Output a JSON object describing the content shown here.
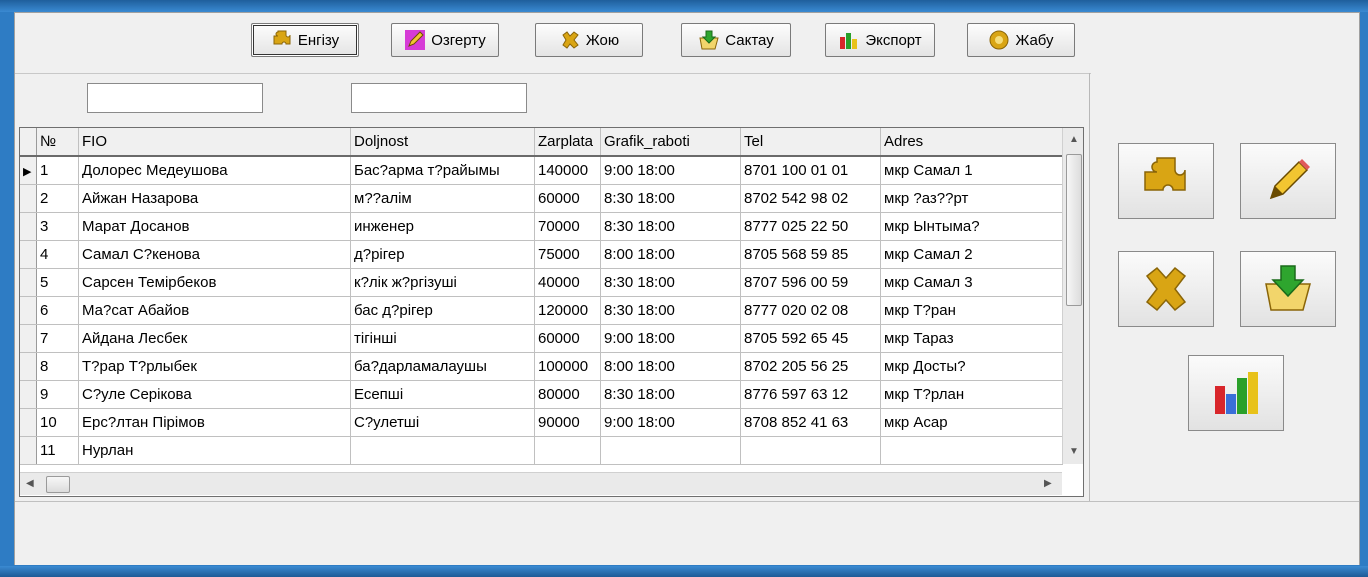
{
  "toolbar": {
    "buttons": [
      {
        "label": "Енгізу",
        "icon": "puzzle-icon"
      },
      {
        "label": "Озгерту",
        "icon": "pencil-icon"
      },
      {
        "label": "Жою",
        "icon": "delete-puzzle-icon"
      },
      {
        "label": "Сактау",
        "icon": "save-icon"
      },
      {
        "label": "Экспорт",
        "icon": "chart-icon"
      },
      {
        "label": "Жабу",
        "icon": "exit-icon"
      }
    ]
  },
  "filters": {
    "filter1": "",
    "filter2": ""
  },
  "table": {
    "columns": [
      "№",
      "FIO",
      "Doljnost",
      "Zarplata",
      "Grafik_raboti",
      "Tel",
      "Adres"
    ],
    "rows": [
      [
        "1",
        "Долорес Медеушова",
        "Бас?арма т?райымы",
        "140000",
        "9:00 18:00",
        "8701 100 01 01",
        "мкр Самал 1"
      ],
      [
        "2",
        " Айжан Назарова",
        "м??алім",
        "60000",
        "8:30 18:00",
        "8702 542 98 02",
        "мкр ?аз??рт"
      ],
      [
        "3",
        "Марат Досанов",
        "инженер",
        "70000",
        "8:30 18:00",
        "8777 025 22 50",
        "мкр Ынтыма?"
      ],
      [
        "4",
        "Самал С?кенова",
        "д?рігер",
        "75000",
        "8:00 18:00",
        "8705 568 59 85",
        "мкр Самал 2"
      ],
      [
        "5",
        "Сарсен Темірбеков",
        "к?лік ж?ргізуші",
        "40000",
        "8:30 18:00",
        "8707 596 00 59",
        "мкр Самал 3"
      ],
      [
        "6",
        "Ма?сат Абайов",
        "бас д?рігер",
        "120000",
        "8:30 18:00",
        "8777 020 02 08",
        "мкр Т?ран"
      ],
      [
        "7",
        "Айдана Лесбек",
        "тігінші",
        "60000",
        "9:00 18:00",
        "8705 592 65 45",
        "мкр Тараз"
      ],
      [
        "8",
        "Т?рар Т?рлыбек",
        "ба?дарламалаушы",
        "100000",
        "8:00 18:00",
        "8702 205 56 25",
        "мкр Досты?"
      ],
      [
        "9",
        "С?уле Серікова",
        "Есепші",
        "80000",
        "8:30 18:00",
        "8776 597 63 12",
        "мкр Т?рлан"
      ],
      [
        "10",
        "Ерс?лтан Пірімов",
        "С?улетші",
        "90000",
        "9:00 18:00",
        "8708 852 41 63",
        "мкр Асар"
      ],
      [
        "11",
        "Нурлан",
        "",
        "",
        "",
        "",
        ""
      ]
    ]
  },
  "side_buttons": [
    "add-puzzle-icon",
    "edit-pencil-icon",
    "delete-puzzle-icon",
    "save-folder-icon",
    "export-chart-icon"
  ],
  "colors": {
    "puzzle": "#d9a514",
    "pencil": "#f2c531",
    "accent": "#2e7cc4"
  }
}
